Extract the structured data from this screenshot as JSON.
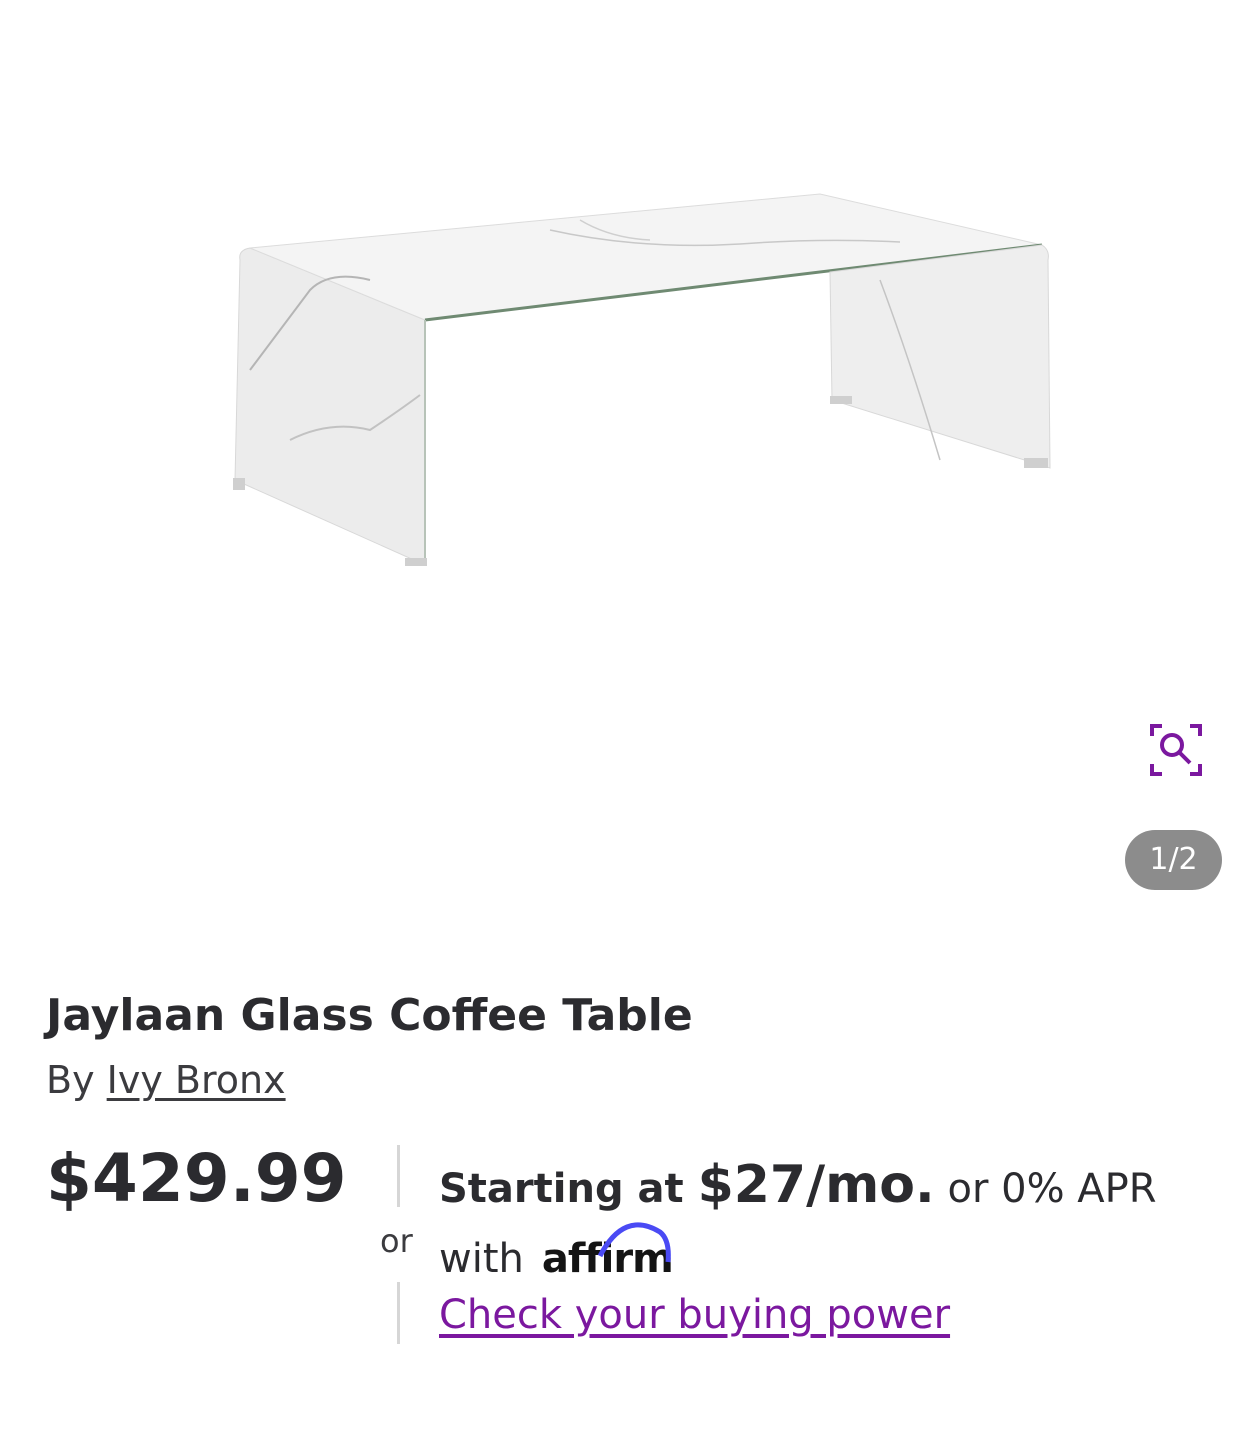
{
  "gallery": {
    "image_alt": "Jaylaan Glass Coffee Table product image",
    "zoom_icon": "zoom-magnifier-icon",
    "counter": "1/2"
  },
  "product": {
    "title": "Jaylaan Glass Coffee Table",
    "by_prefix": "By ",
    "brand": "Ivy Bronx",
    "price": "$429.99"
  },
  "financing": {
    "or_label": "or",
    "starting_at": "Starting at ",
    "monthly": "$27/mo.",
    "apr_text": " or 0% APR",
    "with_text": "with",
    "affirm_logo": "affirm",
    "buying_power_link": "Check your buying power"
  },
  "colors": {
    "accent": "#7b189f",
    "counter_bg": "#8c8c8c",
    "text": "#2b2b2f"
  }
}
